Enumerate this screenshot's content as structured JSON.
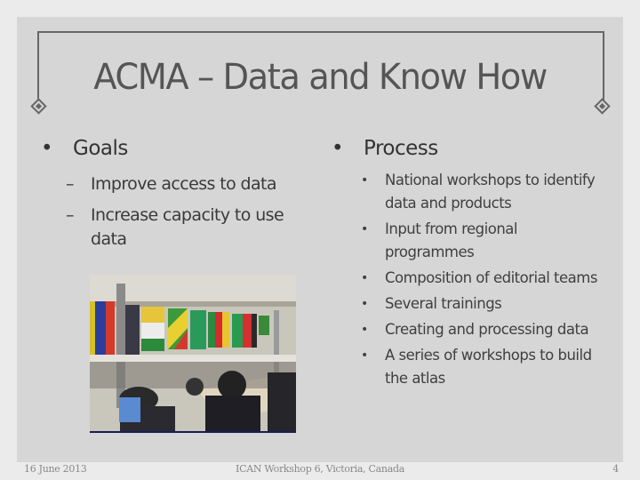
{
  "slide": {
    "title": "ACMA – Data and Know How",
    "left": {
      "heading": "Goals",
      "items": [
        "Improve access to data",
        "Increase capacity to use data"
      ]
    },
    "right": {
      "heading": "Process",
      "items": [
        "National workshops to identify data and products",
        "Input from regional programmes",
        "Composition of editorial teams",
        "Several trainings",
        "Creating and processing data",
        "A series of workshops to build the atlas"
      ]
    },
    "photo": {
      "description": "Workshop meeting room with participants seated at tables and national flags hanging on the wall"
    },
    "footer": {
      "date": "16 June 2013",
      "event": "ICAN Workshop 6, Victoria, Canada",
      "page": "4"
    },
    "icons": {
      "bullet": "•",
      "dash": "–"
    }
  }
}
